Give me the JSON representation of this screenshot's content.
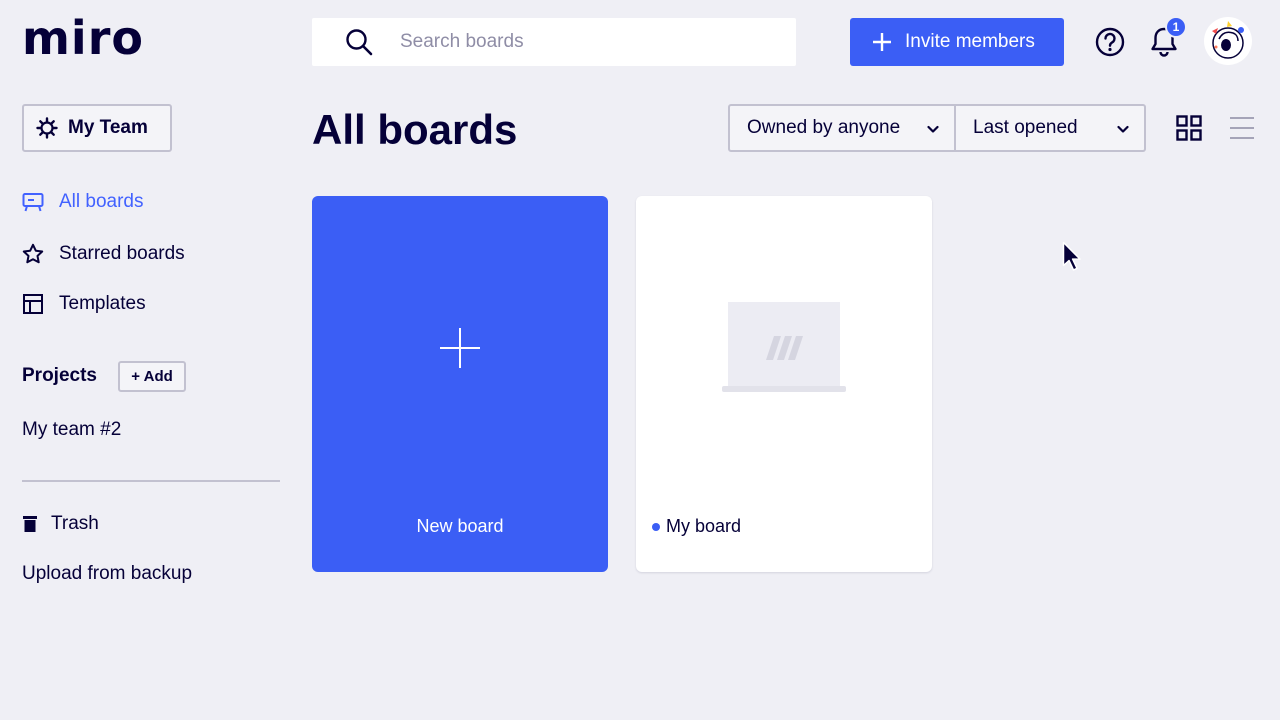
{
  "brand": {
    "logo_text": "miro"
  },
  "header": {
    "search_placeholder": "Search boards",
    "invite_label": "Invite members",
    "notification_count": "1"
  },
  "sidebar": {
    "team_label": "My Team",
    "nav": [
      {
        "label": "All boards",
        "icon": "board-icon",
        "active": true
      },
      {
        "label": "Starred boards",
        "icon": "star-icon",
        "active": false
      },
      {
        "label": "Templates",
        "icon": "templates-icon",
        "active": false
      }
    ],
    "projects_title": "Projects",
    "add_label": "+ Add",
    "projects": [
      {
        "label": "My team #2"
      }
    ],
    "trash_label": "Trash",
    "upload_label": "Upload from backup"
  },
  "main": {
    "title": "All boards",
    "filters": {
      "owner": "Owned by anyone",
      "sort": "Last opened"
    },
    "view_modes": [
      "grid-view-icon",
      "list-view-icon"
    ],
    "new_board_label": "New board",
    "boards": [
      {
        "name": "My board"
      }
    ]
  },
  "colors": {
    "accent": "#3b5ef5",
    "active_nav": "#4262ff",
    "text": "#050038",
    "background": "#efeff5"
  }
}
